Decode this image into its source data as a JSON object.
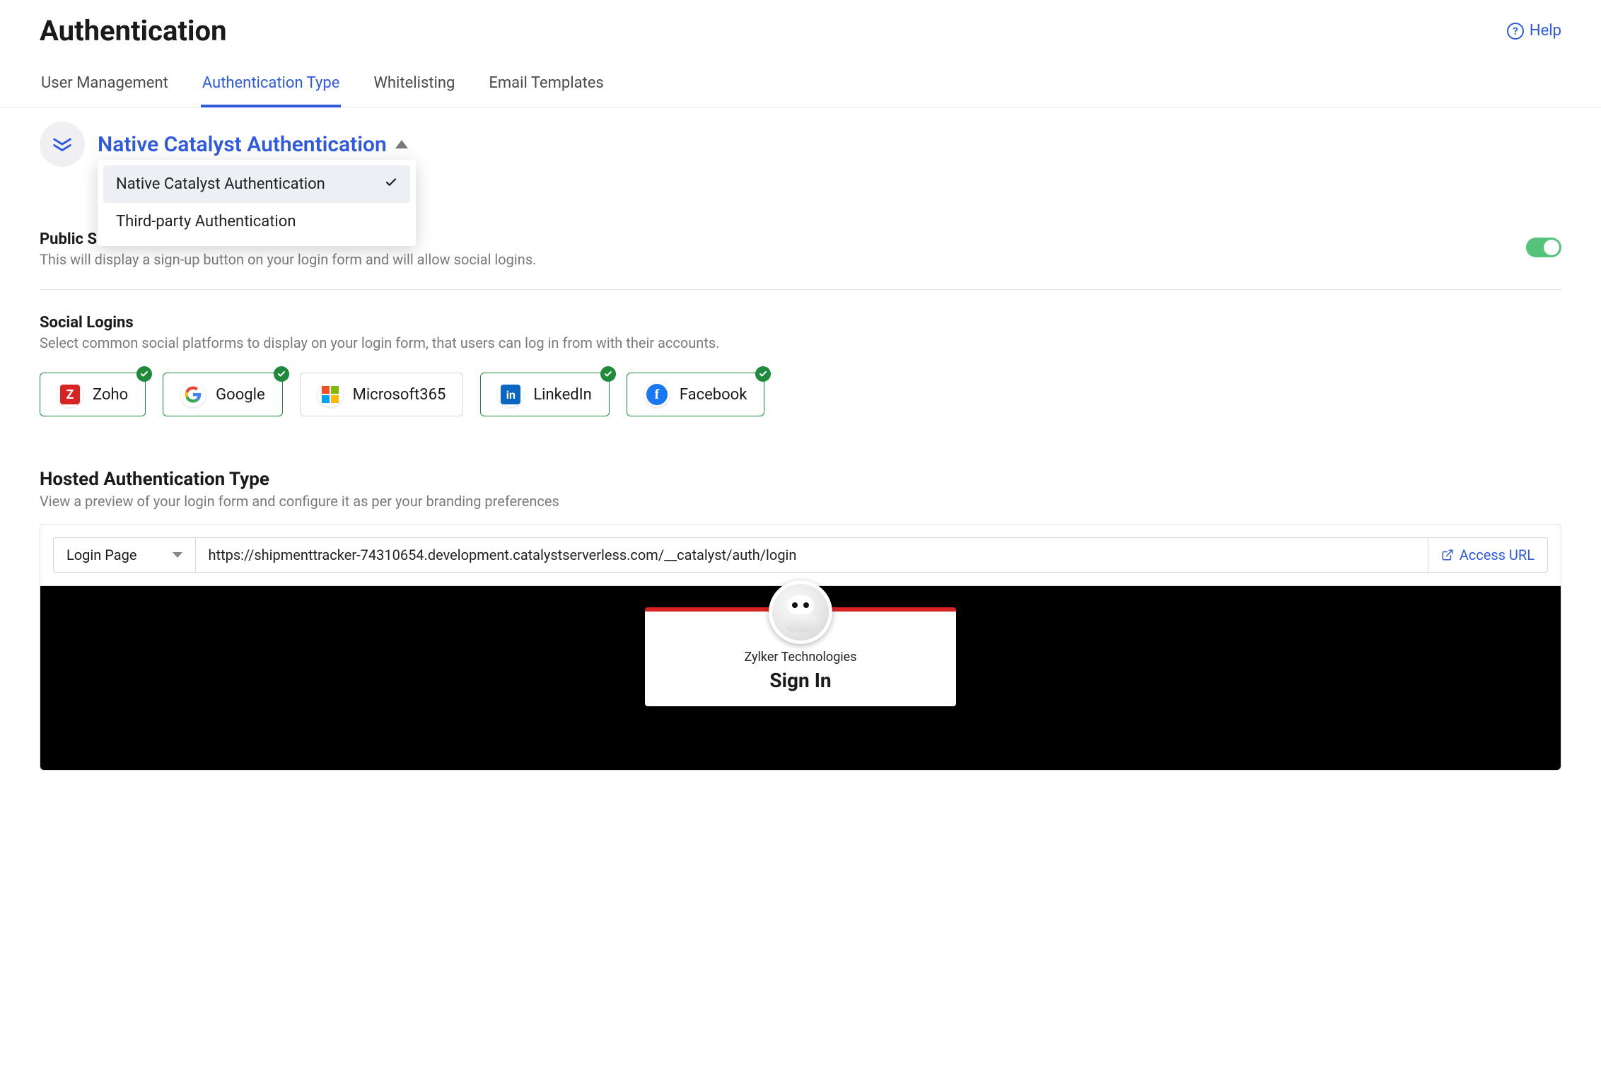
{
  "header": {
    "title": "Authentication",
    "help": "Help"
  },
  "tabs": [
    {
      "label": "User Management",
      "active": false
    },
    {
      "label": "Authentication Type",
      "active": true
    },
    {
      "label": "Whitelisting",
      "active": false
    },
    {
      "label": "Email Templates",
      "active": false
    }
  ],
  "auth_selector": {
    "current": "Native Catalyst Authentication",
    "options": [
      {
        "label": "Native Catalyst Authentication",
        "selected": true
      },
      {
        "label": "Third-party Authentication",
        "selected": false
      }
    ]
  },
  "public_signup": {
    "title_prefix": "Public Si",
    "desc": "This will display a sign-up button on your login form and will allow social logins.",
    "enabled": true
  },
  "social": {
    "title": "Social Logins",
    "desc": "Select common social platforms to display on your login form, that users can log in from with their accounts.",
    "providers": [
      {
        "key": "zoho",
        "label": "Zoho",
        "selected": true
      },
      {
        "key": "google",
        "label": "Google",
        "selected": true
      },
      {
        "key": "microsoft365",
        "label": "Microsoft365",
        "selected": false
      },
      {
        "key": "linkedin",
        "label": "LinkedIn",
        "selected": true
      },
      {
        "key": "facebook",
        "label": "Facebook",
        "selected": true
      }
    ]
  },
  "hosted": {
    "title": "Hosted Authentication Type",
    "desc": "View a preview of your login form and configure it as per your branding preferences",
    "page_select": "Login Page",
    "url": "https://shipmenttracker-74310654.development.catalystserverless.com/__catalyst/auth/login",
    "access_label": "Access URL"
  },
  "preview": {
    "company": "Zylker Technologies",
    "signin": "Sign In"
  }
}
